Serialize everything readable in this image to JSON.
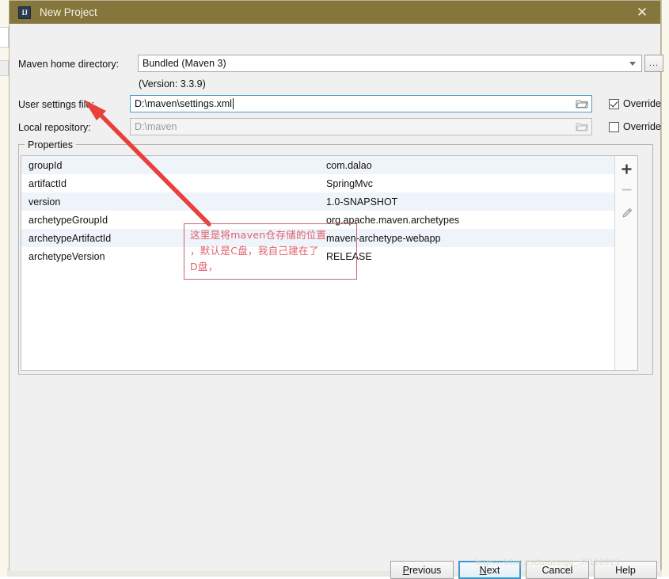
{
  "window": {
    "title": "New Project",
    "app_icon": "IJ",
    "close_icon": "✕"
  },
  "form": {
    "maven_home": {
      "label": "Maven home directory:",
      "value": "Bundled (Maven 3)",
      "browse_label": "...",
      "version_note": "(Version: 3.3.9)"
    },
    "user_settings": {
      "label": "User settings file:",
      "value": "D:\\maven\\settings.xml",
      "override_label": "Override",
      "override_checked": true
    },
    "local_repository": {
      "label": "Local repository:",
      "value": "D:\\maven",
      "override_label": "Override",
      "override_checked": false
    }
  },
  "properties": {
    "legend": "Properties",
    "rows": [
      {
        "key": "groupId",
        "value": "com.dalao"
      },
      {
        "key": "artifactId",
        "value": "SpringMvc"
      },
      {
        "key": "version",
        "value": "1.0-SNAPSHOT"
      },
      {
        "key": "archetypeGroupId",
        "value": "org.apache.maven.archetypes"
      },
      {
        "key": "archetypeArtifactId",
        "value": "maven-archetype-webapp"
      },
      {
        "key": "archetypeVersion",
        "value": "RELEASE"
      }
    ],
    "toolbar": {
      "add": "+",
      "remove": "–",
      "edit": "✎"
    }
  },
  "annotation": {
    "line1": "这里是将maven仓存储的位置",
    "line2": "，默认是C盘，我自己建在了",
    "line3": "D盘，"
  },
  "buttons": {
    "previous": {
      "pre": "",
      "mnemonic": "P",
      "post": "revious"
    },
    "next": {
      "pre": "",
      "mnemonic": "N",
      "post": "ext"
    },
    "cancel": {
      "pre": "",
      "mnemonic": "",
      "post": "Cancel"
    },
    "help": {
      "pre": "",
      "mnemonic": "",
      "post": "Help"
    }
  },
  "watermark": "https://blog.csdn.net/qq_37116915",
  "colors": {
    "titlebar": "#85763b",
    "accent": "#3d95c9",
    "annotation": "#e0606a",
    "row_alt": "#eff3fa"
  }
}
